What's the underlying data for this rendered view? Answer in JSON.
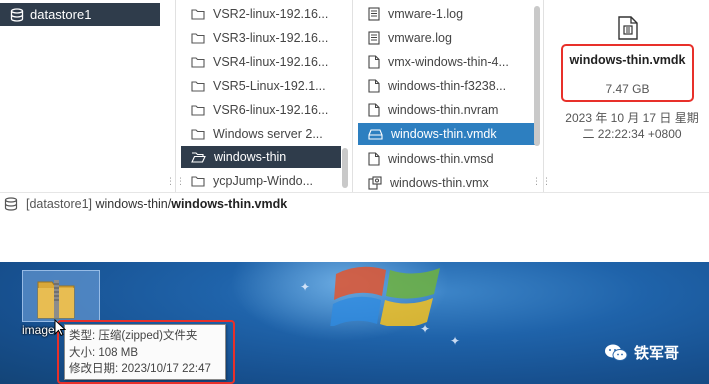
{
  "datastore": {
    "name": "datastore1"
  },
  "folders": [
    "VSR2-linux-192.16...",
    "VSR3-linux-192.16...",
    "VSR4-linux-192.16...",
    "VSR5-Linux-192.1...",
    "VSR6-linux-192.16...",
    "Windows server 2...",
    "windows-thin",
    "ycpJump-Windo..."
  ],
  "files": [
    {
      "name": "vmware-1.log",
      "icon": "log-file-icon"
    },
    {
      "name": "vmware.log",
      "icon": "log-file-icon"
    },
    {
      "name": "vmx-windows-thin-4...",
      "icon": "file-icon"
    },
    {
      "name": "windows-thin-f3238...",
      "icon": "file-icon"
    },
    {
      "name": "windows-thin.nvram",
      "icon": "file-icon"
    },
    {
      "name": "windows-thin.vmdk",
      "icon": "disk-icon"
    },
    {
      "name": "windows-thin.vmsd",
      "icon": "file-icon"
    },
    {
      "name": "windows-thin.vmx",
      "icon": "vm-config-icon"
    }
  ],
  "detail": {
    "name": "windows-thin.vmdk",
    "size": "7.47 GB",
    "date_line1": "2023 年 10 月 17 日 星期",
    "date_line2": "二 22:22:34 +0800"
  },
  "path": {
    "datastore": "[datastore1]",
    "folder": "windows-thin/",
    "file": "windows-thin.vmdk"
  },
  "desktop": {
    "icon_label": "image",
    "tooltip": {
      "type": "类型: 压缩(zipped)文件夹",
      "size": "大小: 108 MB",
      "modified": "修改日期: 2023/10/17 22:47"
    },
    "watermark": "铁军哥"
  },
  "colors": {
    "selected_dark": "#2f3c4b",
    "selected_blue": "#2d7fc0",
    "highlight_red": "#e8302a"
  }
}
